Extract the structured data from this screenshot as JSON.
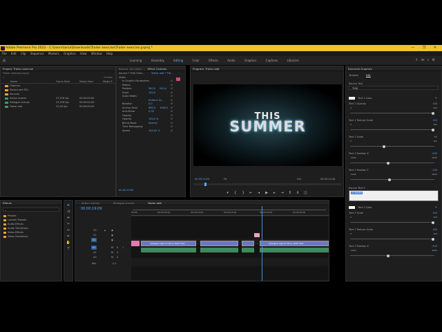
{
  "titlebar": {
    "text": "Adobe Premiere Pro 2022 - C:\\Users\\tania\\Downloads\\Trailer exercise\\Trailer exercise.prproj *",
    "controls": "—  ❐  ✕"
  },
  "menu": [
    "File",
    "Edit",
    "Clip",
    "Sequence",
    "Markers",
    "Graphics",
    "View",
    "Window",
    "Help"
  ],
  "workspaces": [
    "Learning",
    "Assembly",
    "Editing",
    "Color",
    "Effects",
    "Audio",
    "Graphics",
    "Captions",
    "Libraries"
  ],
  "workspace_active": "Editing",
  "project": {
    "tab": "Project: Trailer exercise",
    "file": "Trailer exercise.prproj",
    "items_count": "4 items",
    "columns": [
      "Name",
      "Frame Rate",
      "Media Start",
      "Media E"
    ],
    "rows": [
      {
        "name": "Graphics",
        "type": "folder",
        "fr": "",
        "start": ""
      },
      {
        "name": "Musics and SFx",
        "type": "folder",
        "fr": "",
        "start": ""
      },
      {
        "name": "Sources",
        "type": "folder",
        "fr": "",
        "start": ""
      },
      {
        "name": "Action scenes",
        "type": "seq",
        "fr": "23,976 fps",
        "start": "00:00:00:00"
      },
      {
        "name": "Dialogue scenes",
        "type": "seq",
        "fr": "23,976 fps",
        "start": "00:00:00:00"
      },
      {
        "name": "Trailer edit",
        "type": "seq",
        "fr": "23,00 fps",
        "start": "00:00:00:00"
      }
    ]
  },
  "source_tabs": [
    "Source: (no clips)",
    "Effect Controls",
    "≡"
  ],
  "effect_controls": {
    "source_label": "Source * THIS Outli...",
    "seq_label": "Trailer edit * THI...",
    "section": "Video",
    "rows": [
      {
        "label": "fx  Graphic Parameters",
        "v1": "",
        "v2": ""
      },
      {
        "label": "Motion",
        "v1": "",
        "v2": ""
      },
      {
        "label": "Position",
        "v1": "960,0",
        "v2": "540,0"
      },
      {
        "label": "Scale",
        "v1": "100,0",
        "v2": ""
      },
      {
        "label": "Scale Width",
        "v1": "",
        "v2": ""
      },
      {
        "label": "",
        "v1": "Uniform Sc...",
        "v2": ""
      },
      {
        "label": "Rotation",
        "v1": "0,0",
        "v2": ""
      },
      {
        "label": "Anchor Point",
        "v1": "960,0",
        "v2": "1080,0"
      },
      {
        "label": "Anti-flicker",
        "v1": "0,00",
        "v2": ""
      },
      {
        "label": "Opacity",
        "v1": "",
        "v2": ""
      },
      {
        "label": "Opacity",
        "v1": "100,0 %",
        "v2": ""
      },
      {
        "label": "Blend Mode",
        "v1": "Normal",
        "v2": ""
      },
      {
        "label": "Time Remapping",
        "v1": "",
        "v2": ""
      },
      {
        "label": "Speed",
        "v1": "100,00 %",
        "v2": ""
      }
    ],
    "timecode": "00:00:19:09"
  },
  "program": {
    "tab": "Program: Trailer edit",
    "title_line1": "THIS",
    "title_line2": "SUMMER",
    "timecode": "00:00:19:09",
    "fit": "Fit",
    "quality": "Full",
    "duration": "00:03:13:18"
  },
  "essential_graphics": {
    "tab": "Essential Graphics",
    "subtabs": [
      "Browse",
      "Edit"
    ],
    "active_subtab": "Edit",
    "source_text_label": "Source Text",
    "source_text_value": "THIS",
    "text1_color_label": "Text 1 Color",
    "controls_top": [
      {
        "label": "Text 1 Opacity",
        "min": "0",
        "max": "100",
        "value": "100",
        "level": 1.0
      },
      {
        "label": "Text 1 Texture Scale",
        "min": "0",
        "max": "100",
        "value": "100",
        "level": 1.0
      },
      {
        "label": "Text 1 Scale",
        "min": "0",
        "max": "100",
        "value": "40",
        "level": 0.4
      },
      {
        "label": "Text 1 Position X",
        "min": "-2000",
        "max": "2000",
        "value": "-200",
        "level": 0.45
      },
      {
        "label": "Text 1 Position Y",
        "min": "-2000",
        "max": "2000",
        "value": "-140",
        "level": 0.465
      }
    ],
    "source_text2_label": "Source Text 2",
    "source_text2_value": "SUMMER",
    "text2_color_label": "Text 2 Color",
    "controls_bottom": [
      {
        "label": "Text 2 Scale",
        "min": "0",
        "max": "100",
        "value": "100",
        "level": 1.0
      },
      {
        "label": "Text 2 Texture Scale",
        "min": "0",
        "max": "100",
        "value": "100",
        "level": 1.0
      },
      {
        "label": "Text 2 Position X",
        "min": "-2000",
        "max": "2000",
        "value": "-200",
        "level": 0.45
      }
    ]
  },
  "effects_panel": {
    "tab": "Effects",
    "items": [
      "Presets",
      "Lumetri Presets",
      "Audio Effects",
      "Audio Transitions",
      "Video Effects",
      "Video Transitions"
    ]
  },
  "timeline": {
    "tabs": [
      "Action scenes",
      "Dialogue scenes",
      "Trailer edit"
    ],
    "active_tab": "Trailer edit",
    "timecode": "00:00:19:09",
    "ruler": [
      "00:00",
      "00:00:05:00",
      "00:00:10:00",
      "00:00:15:00",
      "00:00:20:00",
      "00:00:25:00"
    ],
    "video_tracks": [
      "V3",
      "V2",
      "V1"
    ],
    "audio_tracks": [
      "A1",
      "A2",
      "A3"
    ],
    "master": "Mix",
    "master_value": "0,0",
    "clip_label": "Avengers Age of Ultron 2015 Trail"
  }
}
